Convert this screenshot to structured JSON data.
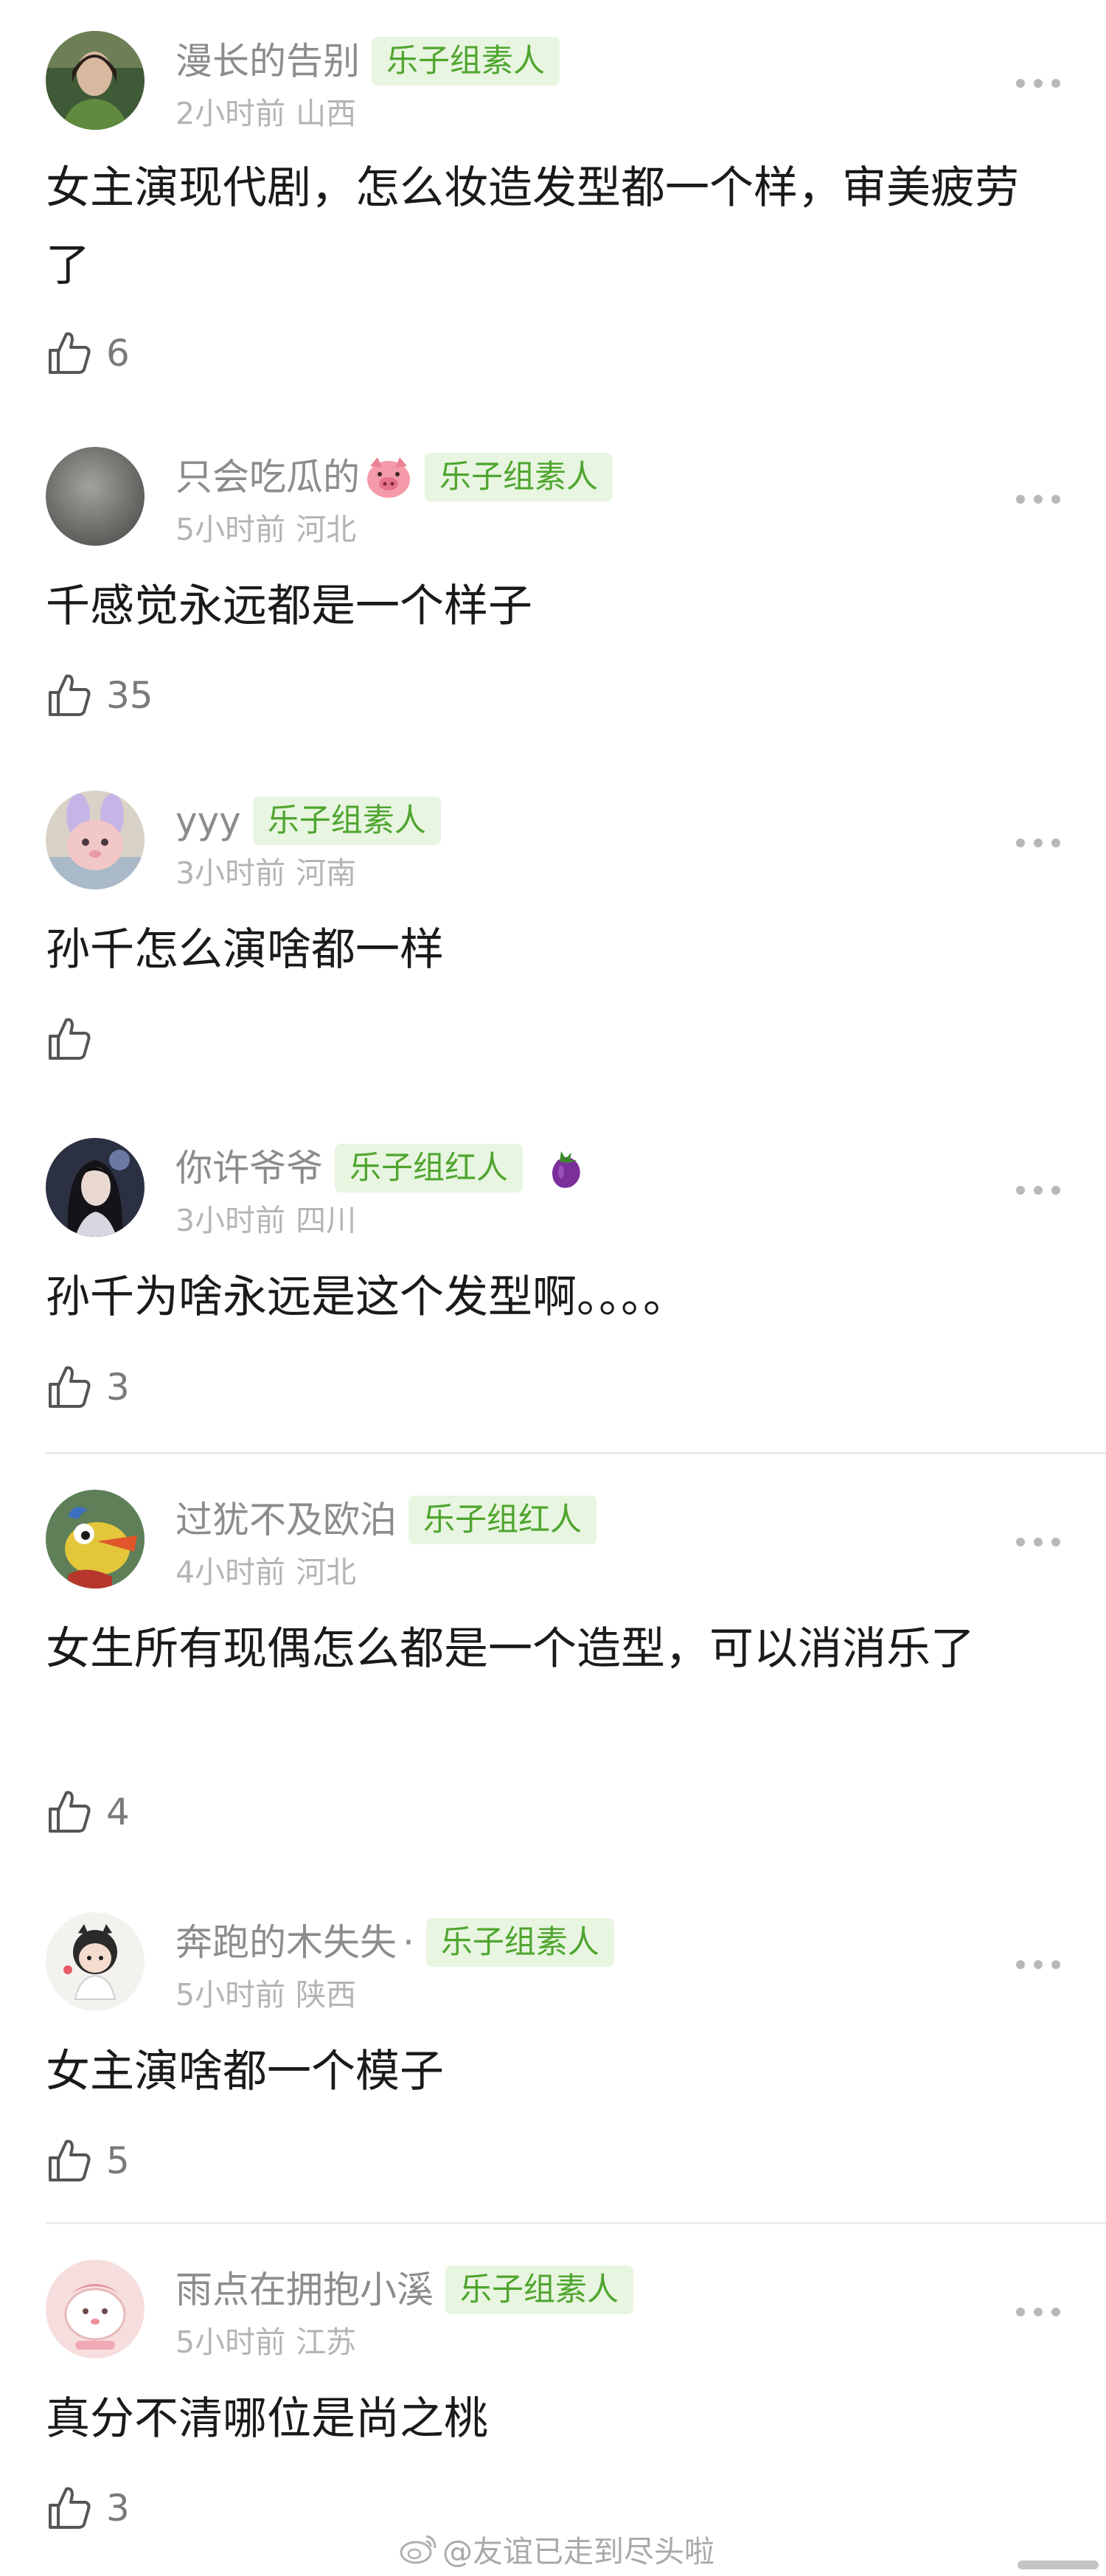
{
  "comments": [
    {
      "username": "漫长的告别",
      "badge": "乐子组素人",
      "time": "2小时前",
      "location": "山西",
      "text": "女主演现代剧，怎么妆造发型都一个样，审美疲劳了",
      "likes": "6",
      "avatar_icon": "woman-in-green-avatar",
      "colors": {
        "avatar_bg": "#3f5a36"
      }
    },
    {
      "username": "只会吃瓜的",
      "badge": "乐子组素人",
      "time": "5小时前",
      "location": "河北",
      "text": "千感觉永远都是一个样子",
      "likes": "35",
      "avatar_icon": "gray-blur-avatar",
      "emoji_icon": "pig-face-emoji",
      "colors": {
        "avatar_bg": "#7b7a77"
      }
    },
    {
      "username": "yyy",
      "badge": "乐子组素人",
      "time": "3小时前",
      "location": "河南",
      "text": "孙千怎么演啥都一样",
      "likes": "",
      "avatar_icon": "pink-bunny-plush-avatar",
      "colors": {
        "avatar_bg": "#d9d2c6"
      }
    },
    {
      "username": "你许爷爷",
      "badge": "乐子组红人",
      "time": "3小时前",
      "location": "四川",
      "text": "孙千为啥永远是这个发型啊。。。。",
      "likes": "3",
      "avatar_icon": "dark-hair-character-avatar",
      "extra_icon": "eggplant-icon",
      "colors": {
        "avatar_bg": "#2b3042"
      }
    },
    {
      "username": "过犹不及欧泊",
      "badge": "乐子组红人",
      "time": "4小时前",
      "location": "河北",
      "text": "女生所有现偶怎么都是一个造型，可以消消乐了",
      "likes": "4",
      "avatar_icon": "cartoon-bird-avatar",
      "colors": {
        "avatar_bg": "#5e7f58"
      }
    },
    {
      "username": "奔跑的木失失",
      "separator": "·",
      "badge": "乐子组素人",
      "time": "5小时前",
      "location": "陕西",
      "text": "女主演啥都一个模子",
      "likes": "5",
      "avatar_icon": "chibi-girl-avatar",
      "colors": {
        "avatar_bg": "#f4f2ef"
      }
    },
    {
      "username": "雨点在拥抱小溪",
      "badge": "乐子组素人",
      "time": "5小时前",
      "location": "江苏",
      "text": "真分不清哪位是尚之桃",
      "likes": "3",
      "avatar_icon": "pink-cartoon-avatar",
      "colors": {
        "avatar_bg": "#f6dede"
      }
    }
  ],
  "watermark": "@友谊已走到尽头啦",
  "colors": {
    "badge_text": "#4fa52f",
    "badge_bg": "#e8f5e0",
    "meta_text": "#b4b4b4",
    "username_text": "#8c8c8c"
  }
}
